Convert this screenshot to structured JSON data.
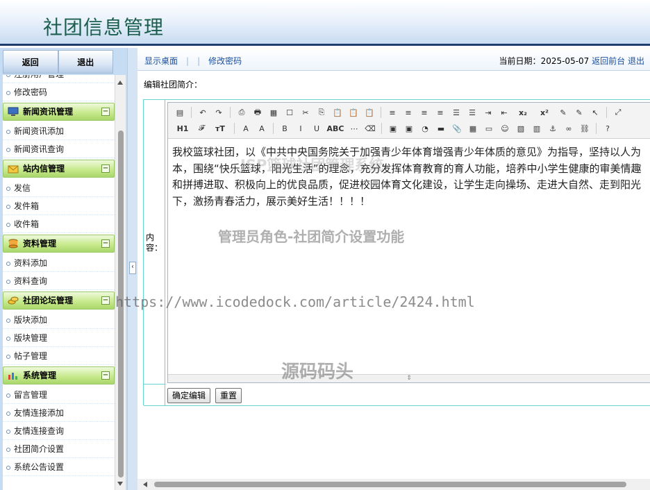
{
  "app": {
    "title": "社团信息管理"
  },
  "sidebar": {
    "top_buttons": {
      "back": "返回",
      "logout": "退出"
    },
    "partial_item": "注册用户管理",
    "items_before": [
      {
        "label": "修改密码"
      }
    ],
    "groups": [
      {
        "title": "新闻资讯管理",
        "collapse": "−",
        "items": [
          {
            "label": "新闻资讯添加"
          },
          {
            "label": "新闻资讯查询"
          }
        ]
      },
      {
        "title": "站内信管理",
        "collapse": "−",
        "items": [
          {
            "label": "发信"
          },
          {
            "label": "发件箱"
          },
          {
            "label": "收件箱"
          }
        ]
      },
      {
        "title": "资料管理",
        "collapse": "−",
        "items": [
          {
            "label": "资料添加"
          },
          {
            "label": "资料查询"
          }
        ]
      },
      {
        "title": "社团论坛管理",
        "collapse": "−",
        "items": [
          {
            "label": "版块添加"
          },
          {
            "label": "版块管理"
          },
          {
            "label": "帖子管理"
          }
        ]
      },
      {
        "title": "系统管理",
        "collapse": "−",
        "items": [
          {
            "label": "留言管理"
          },
          {
            "label": "友情连接添加"
          },
          {
            "label": "友情连接查询"
          },
          {
            "label": "社团简介设置"
          },
          {
            "label": "系统公告设置"
          }
        ]
      }
    ],
    "splitter_arrow": "‹"
  },
  "topbar": {
    "desktop": "显示桌面",
    "change_password": "修改密码",
    "date_label": "当前日期：",
    "date": "2025-05-07",
    "back_front": "返回前台",
    "logout": "退出"
  },
  "form": {
    "section_title": "编辑社团简介：",
    "content_label": "内容：",
    "content": "我校篮球社团，以《中共中央国务院关于加强青少年体育增强青少年体质的意见》为指导，坚持以人为本，围绕“快乐篮球，阳光生活”的理念，充分发挥体育教育的育人功能，培养中小学生健康的审美情趣和拼搏进取、积极向上的优良品质，促进校园体育文化建设，让学生走向操场、走进大自然、走到阳光下，激扬青春活力，展示美好生活！！！！",
    "submit": "确定编辑",
    "reset": "重置"
  },
  "editor": {
    "row1": [
      "▤",
      "↶",
      "↷",
      "⎙",
      "🖶",
      "▦",
      "☐",
      "✂",
      "⎘",
      "📋",
      "📋",
      "📋",
      "≡",
      "≡",
      "≡",
      "≡",
      "☰",
      "☰",
      "⇥",
      "⇤",
      "x₂",
      "x²",
      "✎",
      "✎",
      "↖",
      "⤢"
    ],
    "row2": [
      "H1",
      "𝓕",
      "тT",
      "A",
      "A",
      "B",
      "I",
      "U",
      "ABC",
      "⋯",
      "⌫",
      "▣",
      "▣",
      "◔",
      "▬",
      "📎",
      "▦",
      "▭",
      "☺",
      "▧",
      "▥",
      "⚓",
      "∞",
      "⛓",
      "?"
    ]
  },
  "watermarks": {
    "role": "管理员角色-社团简介设置功能",
    "system": "JSP篮球社团管理系统",
    "url": "https://www.icodedock.com/article/2424.html",
    "source": "源码码头"
  }
}
